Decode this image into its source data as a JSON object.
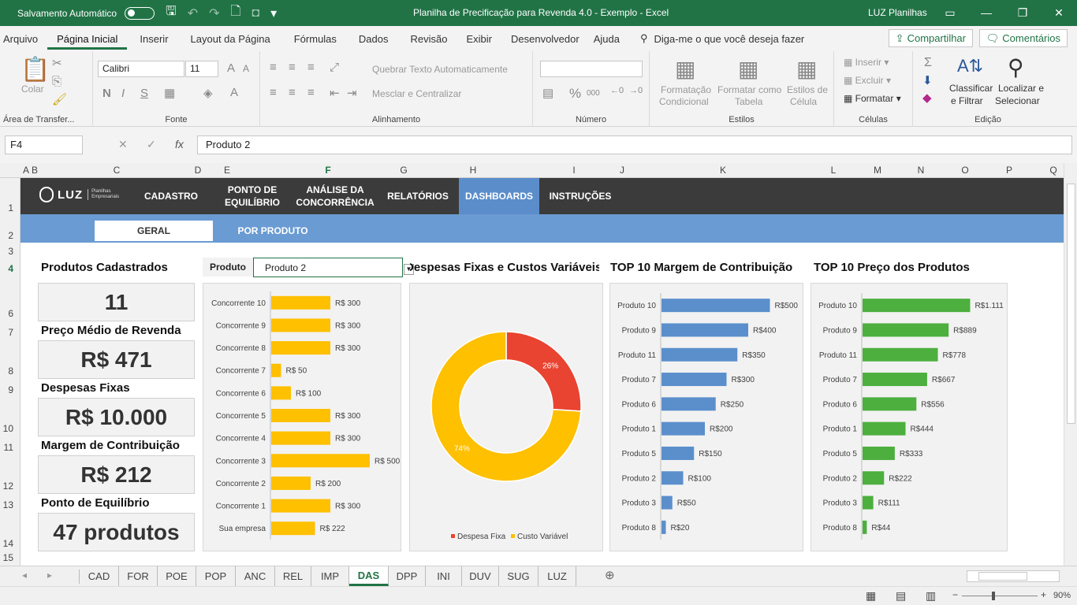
{
  "titlebar": {
    "autosave": "Salvamento Automático",
    "doc": "Planilha de Precificação para Revenda 4.0 - Exemplo  -  Excel",
    "user": "LUZ Planilhas"
  },
  "menu": [
    "Arquivo",
    "Página Inicial",
    "Inserir",
    "Layout da Página",
    "Fórmulas",
    "Dados",
    "Revisão",
    "Exibir",
    "Desenvolvedor",
    "Ajuda"
  ],
  "tellme": "Diga-me o que você deseja fazer",
  "share": "Compartilhar",
  "comments": "Comentários",
  "ribbon": {
    "paste": "Colar",
    "clipboard": "Área de Transfer...",
    "font_name": "Calibri",
    "font_size": "11",
    "font": "Fonte",
    "bold": "N",
    "italic": "I",
    "underline": "S",
    "wrap": "Quebrar Texto Automaticamente",
    "merge": "Mesclar e Centralizar",
    "alignment": "Alinhamento",
    "number": "Número",
    "percent": "%",
    "thousands": "000",
    "cond1": "Formatação",
    "cond2": "Condicional",
    "table1": "Formatar como",
    "table2": "Tabela",
    "style1": "Estilos de",
    "style2": "Célula",
    "styles": "Estilos",
    "insert": "Inserir",
    "delete": "Excluir",
    "format": "Formatar",
    "cells": "Células",
    "sort1": "Classificar",
    "sort2": "e Filtrar",
    "find1": "Localizar e",
    "find2": "Selecionar",
    "editing": "Edição"
  },
  "namebox": "F4",
  "formula": "Produto 2",
  "columns": [
    "A",
    "B",
    "C",
    "D",
    "E",
    "F",
    "G",
    "H",
    "I",
    "J",
    "K",
    "L",
    "M",
    "N",
    "O",
    "P",
    "Q"
  ],
  "rows": [
    "1",
    "2",
    "3",
    "4",
    "6",
    "7",
    "8",
    "9",
    "10",
    "11",
    "12",
    "13",
    "14",
    "15"
  ],
  "nav": {
    "logo": "LUZ",
    "logo_sub1": "Planilhas",
    "logo_sub2": "Empresariais",
    "items": [
      "CADASTRO",
      "PONTO DE",
      "EQUILÍBRIO",
      "ANÁLISE DA",
      "CONCORRÊNCIA",
      "RELATÓRIOS",
      "DASHBOARDS",
      "INSTRUÇÕES"
    ]
  },
  "subtabs": [
    "GERAL",
    "POR PRODUTO"
  ],
  "kpis": [
    {
      "title": "Produtos Cadastrados",
      "value": "11"
    },
    {
      "title": "Preço Médio de Revenda",
      "value": "R$ 471"
    },
    {
      "title": "Despesas Fixas",
      "value": "R$ 10.000"
    },
    {
      "title": "Margem de Contribuição",
      "value": "R$ 212"
    },
    {
      "title": "Ponto de Equilíbrio",
      "value": "47 produtos"
    }
  ],
  "product_filter": {
    "label": "Produto",
    "value": "Produto 2"
  },
  "chart_data": [
    {
      "type": "bar",
      "orientation": "horizontal",
      "title": "",
      "categories": [
        "Concorrente 10",
        "Concorrente 9",
        "Concorrente 8",
        "Concorrente 7",
        "Concorrente 6",
        "Concorrente 5",
        "Concorrente 4",
        "Concorrente 3",
        "Concorrente 2",
        "Concorrente 1",
        "Sua empresa"
      ],
      "values": [
        300,
        300,
        300,
        50,
        100,
        300,
        300,
        500,
        200,
        300,
        222
      ],
      "labels": [
        "R$ 300",
        "R$ 300",
        "R$ 300",
        "R$ 50",
        "R$ 100",
        "R$ 300",
        "R$ 300",
        "R$ 500",
        "R$ 200",
        "R$ 300",
        "R$ 222"
      ],
      "color": "#ffc000",
      "xlim": [
        0,
        520
      ]
    },
    {
      "type": "pie",
      "variant": "donut",
      "title": "Despesas Fixas e Custos Variáveis",
      "slices": [
        {
          "name": "Despesa Fixa",
          "value": 26,
          "label": "26%",
          "color": "#e94431"
        },
        {
          "name": "Custo Variável",
          "value": 74,
          "label": "74%",
          "color": "#ffc000"
        }
      ],
      "legend": "bottom"
    },
    {
      "type": "bar",
      "orientation": "horizontal",
      "title": "TOP 10 Margem de Contribuição",
      "categories": [
        "Produto 10",
        "Produto 9",
        "Produto 11",
        "Produto 7",
        "Produto 6",
        "Produto 1",
        "Produto 5",
        "Produto 2",
        "Produto 3",
        "Produto 8"
      ],
      "values": [
        500,
        400,
        350,
        300,
        250,
        200,
        150,
        100,
        50,
        20
      ],
      "labels": [
        "R$500",
        "R$400",
        "R$350",
        "R$300",
        "R$250",
        "R$200",
        "R$150",
        "R$100",
        "R$50",
        "R$20"
      ],
      "color": "#5b8fcc",
      "xlim": [
        0,
        520
      ]
    },
    {
      "type": "bar",
      "orientation": "horizontal",
      "title": "TOP 10 Preço dos Produtos",
      "categories": [
        "Produto 10",
        "Produto 9",
        "Produto 11",
        "Produto 7",
        "Produto 6",
        "Produto 1",
        "Produto 5",
        "Produto 2",
        "Produto 3",
        "Produto 8"
      ],
      "values": [
        1111,
        889,
        778,
        667,
        556,
        444,
        333,
        222,
        111,
        44
      ],
      "labels": [
        "R$1.111",
        "R$889",
        "R$778",
        "R$667",
        "R$556",
        "R$444",
        "R$333",
        "R$222",
        "R$111",
        "R$44"
      ],
      "color": "#4caf3e",
      "xlim": [
        0,
        1140
      ]
    }
  ],
  "sheet_tabs": [
    "CAD",
    "FOR",
    "POE",
    "POP",
    "ANC",
    "REL",
    "IMP",
    "DAS",
    "DPP",
    "INI",
    "DUV",
    "SUG",
    "LUZ"
  ],
  "active_tab": "DAS",
  "zoom": "90%",
  "colors": {
    "excel_green": "#217346",
    "nav_dark": "#3b3b3b",
    "nav_blue": "#6a9bd2"
  }
}
